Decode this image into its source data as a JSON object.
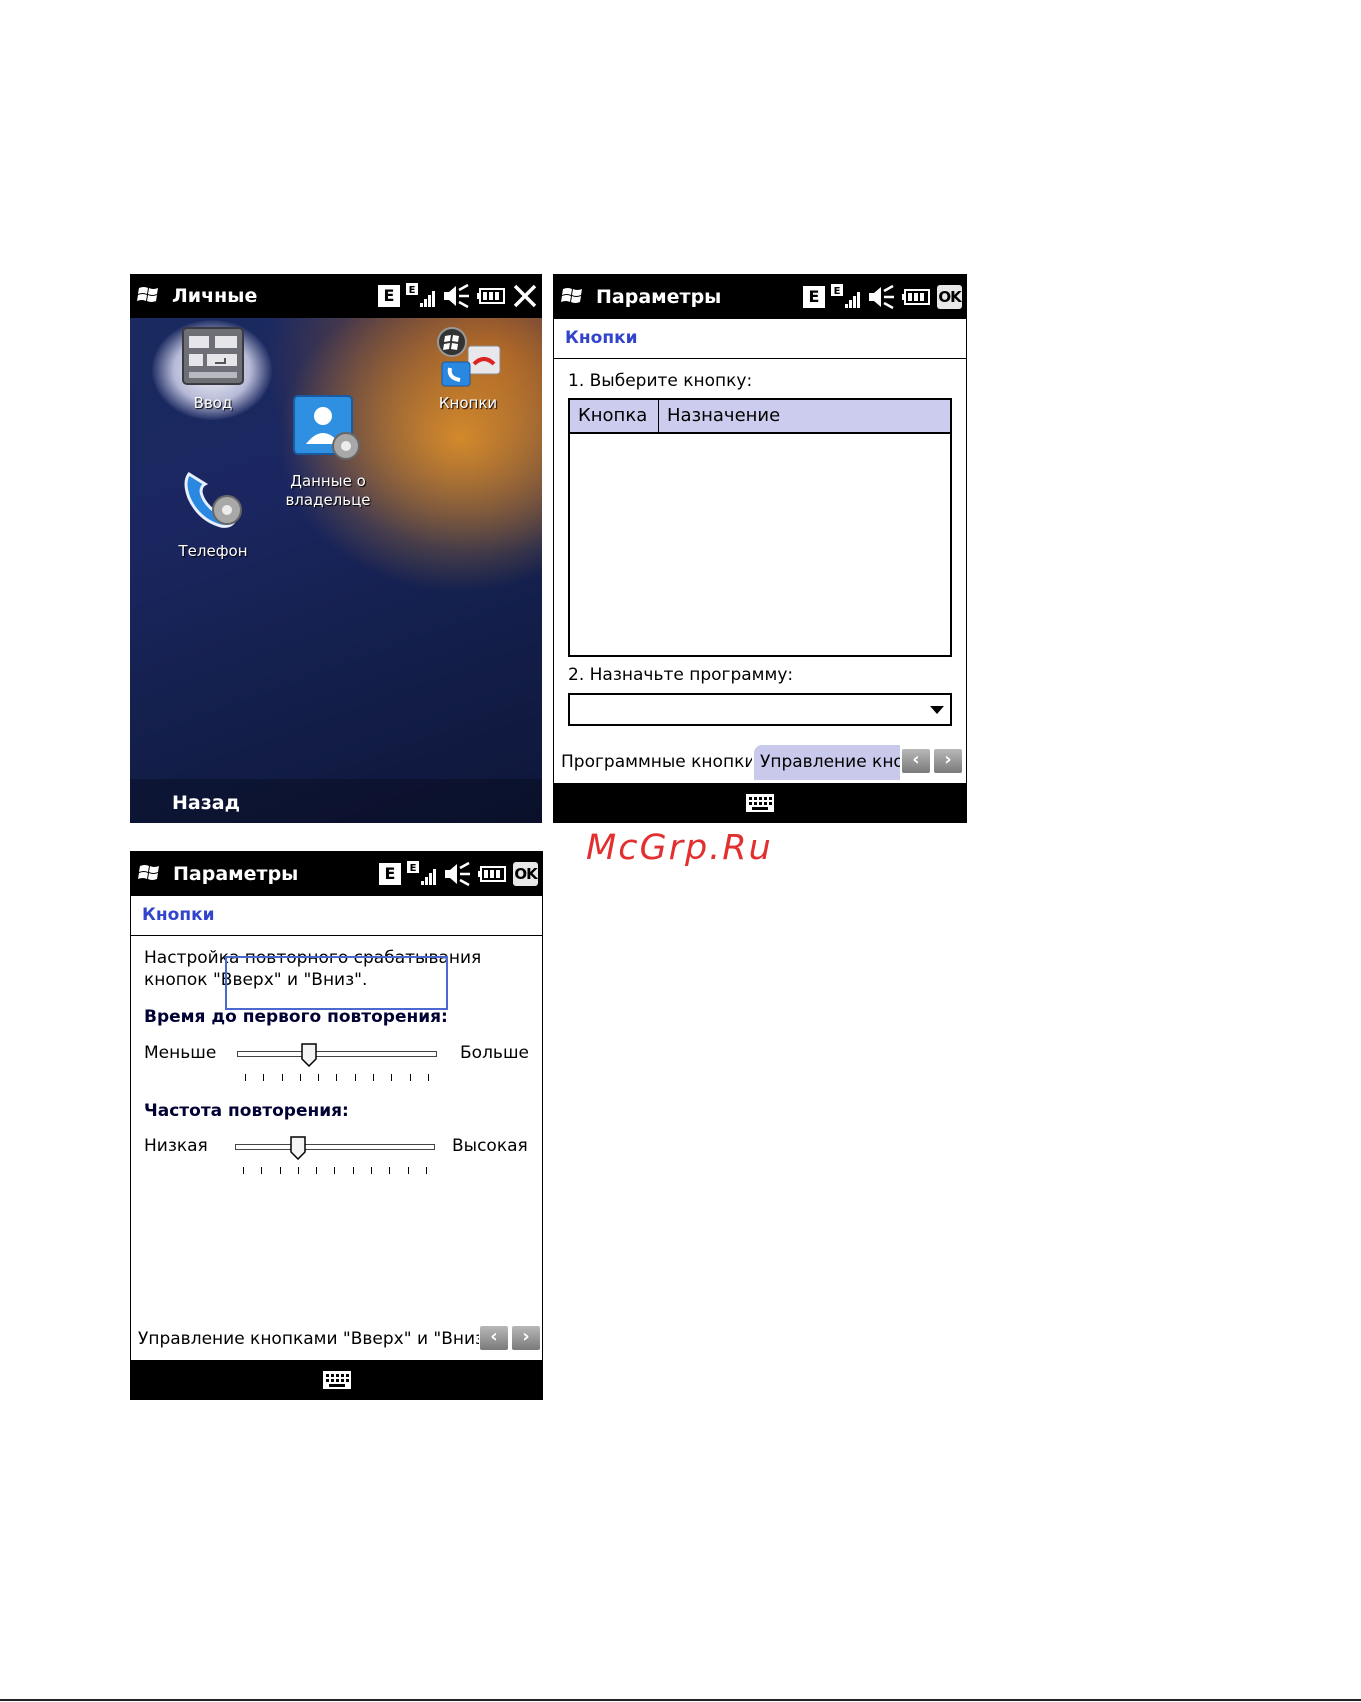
{
  "personal_screen": {
    "title": "Личные",
    "tray": {
      "edge_label": "E",
      "signal_label": "E"
    },
    "apps": [
      {
        "label": "Ввод",
        "icon": "input-icon"
      },
      {
        "label": "Данные о владельце",
        "icon": "owner-info-icon"
      },
      {
        "label": "Кнопки",
        "icon": "buttons-icon"
      },
      {
        "label": "Телефон",
        "icon": "phone-settings-icon"
      }
    ],
    "softkey_left": "Назад"
  },
  "buttons_screen": {
    "title": "Параметры",
    "tray": {
      "edge_label": "E",
      "signal_label": "E",
      "ok_label": "OK"
    },
    "section_title": "Кнопки",
    "step1_label": "1. Выберите кнопку:",
    "table": {
      "columns": [
        "Кнопка",
        "Назначение"
      ],
      "rows": []
    },
    "step2_label": "2. Назначьте программу:",
    "program_value": "",
    "tabs": [
      {
        "label": "Программные кнопки",
        "active": true
      },
      {
        "label": "Управление кнопками \"Вверх\" и \"Вниз\"",
        "active": false
      }
    ]
  },
  "updown_screen": {
    "title": "Параметры",
    "tray": {
      "edge_label": "E",
      "signal_label": "E",
      "ok_label": "OK"
    },
    "section_title": "Кнопки",
    "description_line1": "Настройка повторного срабатывания",
    "description_line2": "кнопок \"Вверх\" и \"Вниз\".",
    "delay": {
      "label": "Время до первого повторения:",
      "min_label": "Меньше",
      "max_label": "Больше",
      "value_fraction": 0.35,
      "ticks": 11
    },
    "rate": {
      "label": "Частота повторения:",
      "min_label": "Низкая",
      "max_label": "Высокая",
      "value_fraction": 0.3,
      "ticks": 11
    },
    "tabs": [
      {
        "label": "Управление кнопками \"Вверх\" и \"Вниз\"",
        "active": true
      }
    ]
  },
  "watermark": "McGrp.Ru",
  "colors": {
    "section_title": "#3344cc",
    "tab_inactive": "#c9c9ec",
    "grid_header": "#ccccee",
    "focus_border": "#4a6ad0",
    "watermark": "#e23030"
  }
}
